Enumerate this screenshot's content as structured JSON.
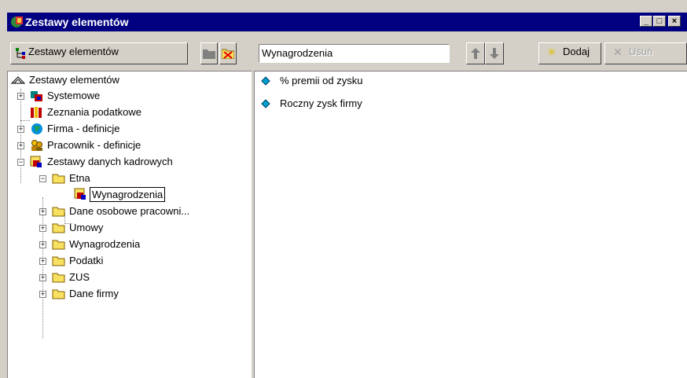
{
  "window": {
    "title": "Zestawy elementów",
    "controls": [
      "_",
      "□",
      "×"
    ]
  },
  "toolbar": {
    "tree_button_label": "Zestawy elementów",
    "selected_set_value": "Wynagrodzenia",
    "add_label": "Dodaj",
    "remove_label": "Usuń"
  },
  "tree": {
    "root": "Zestawy elementów",
    "items": [
      {
        "label": "Systemowe"
      },
      {
        "label": "Zeznania podatkowe"
      },
      {
        "label": "Firma - definicje"
      },
      {
        "label": "Pracownik - definicje"
      },
      {
        "label": "Zestawy danych kadrowych"
      },
      {
        "label": "Etna"
      },
      {
        "label": "Wynagrodzenia"
      },
      {
        "label": "Dane osobowe pracowni..."
      },
      {
        "label": "Umowy"
      },
      {
        "label": "Wynagrodzenia"
      },
      {
        "label": "Podatki"
      },
      {
        "label": "ZUS"
      },
      {
        "label": "Dane firmy"
      }
    ]
  },
  "list": {
    "items": [
      {
        "label": "% premii od zysku"
      },
      {
        "label": "Roczny zysk firmy"
      }
    ]
  },
  "colors": {
    "titlebar": "#000080",
    "face": "#d4d0c8",
    "accent_yellow": "#f8e060"
  }
}
